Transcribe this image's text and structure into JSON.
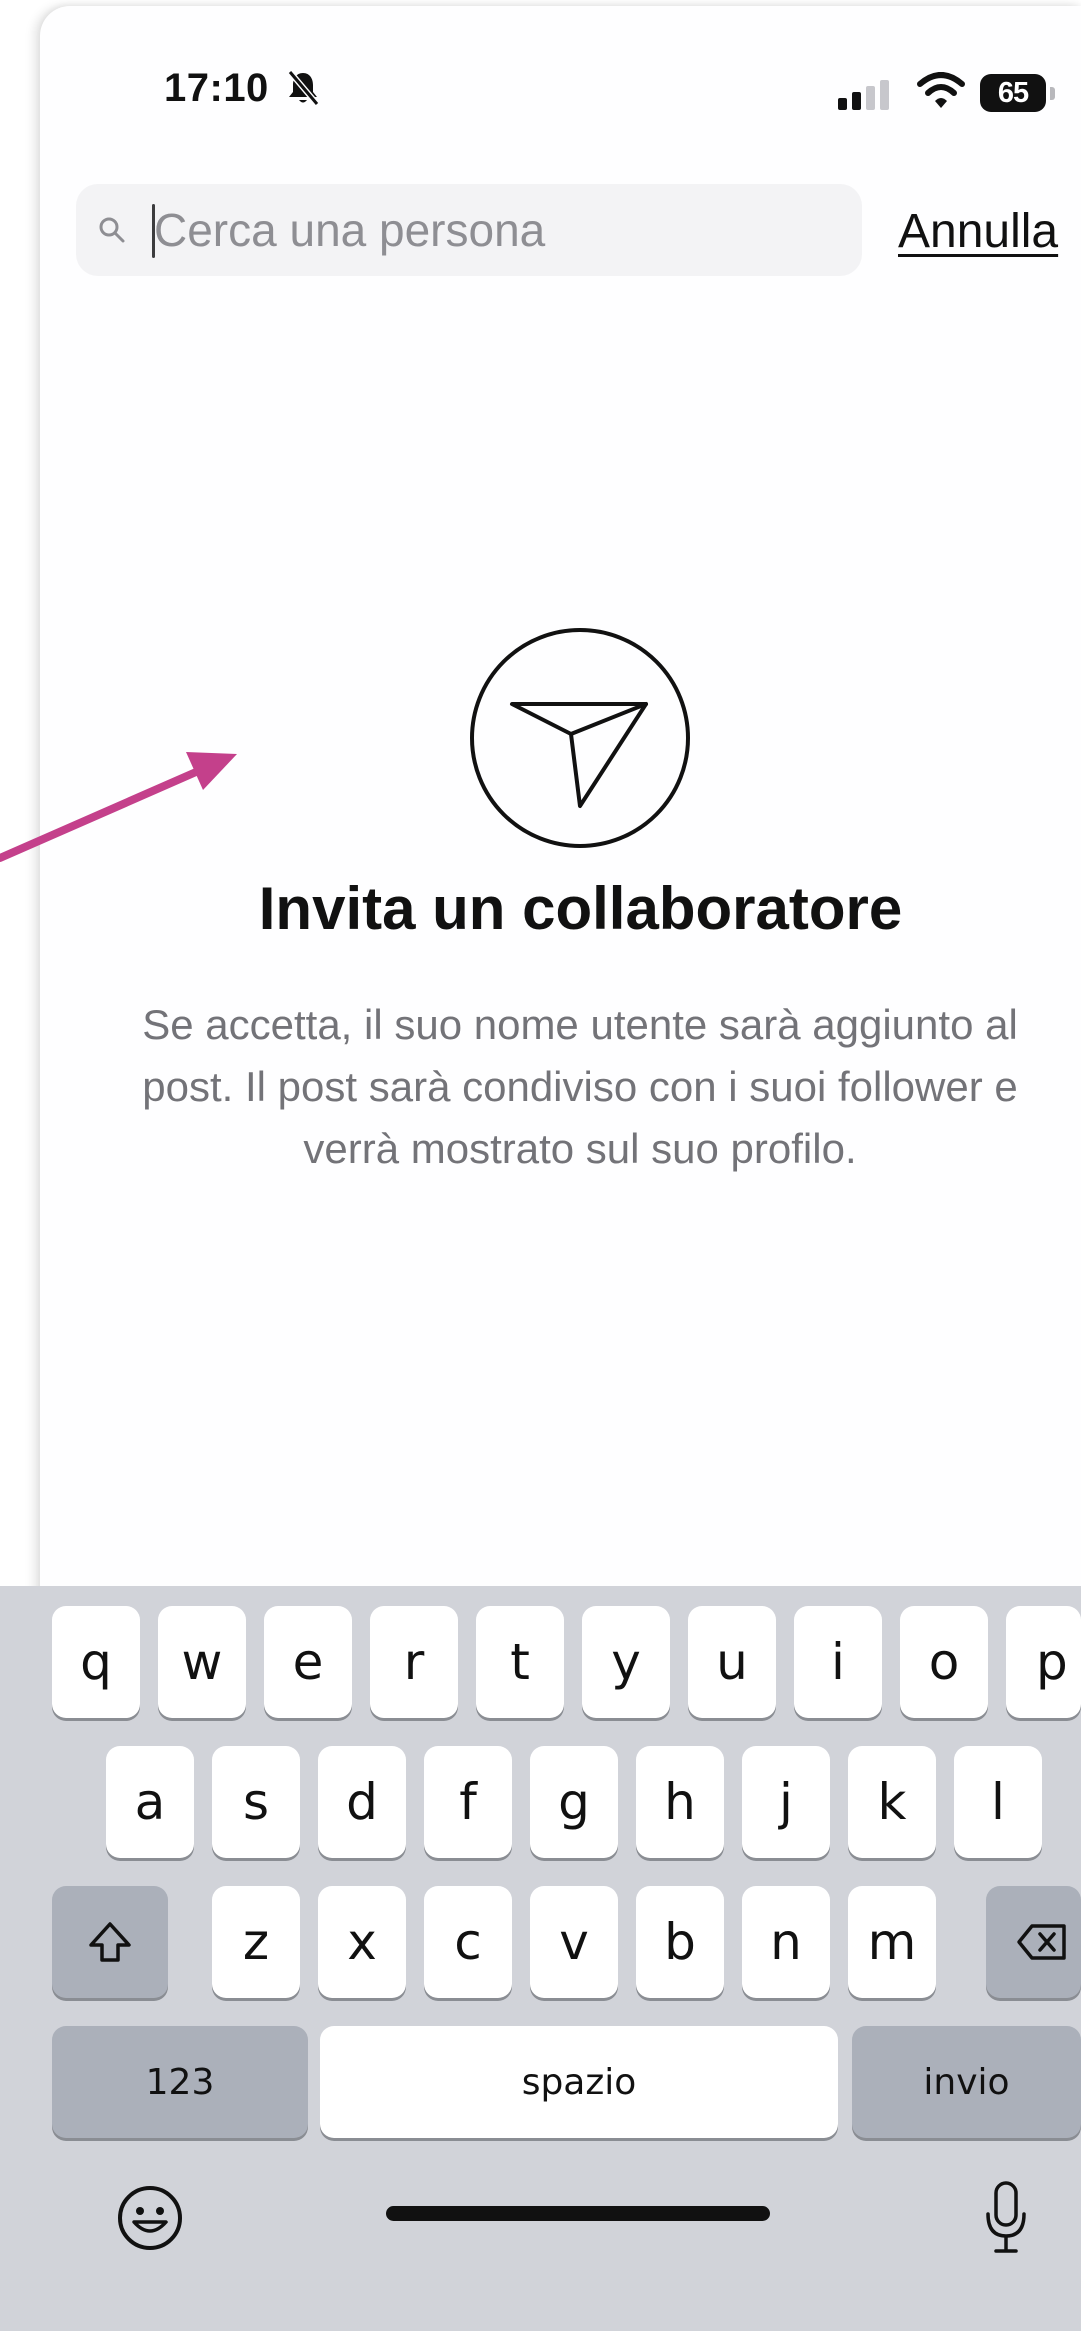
{
  "status_bar": {
    "time": "17:10",
    "battery": "65"
  },
  "search": {
    "placeholder": "Cerca una persona",
    "value": "",
    "cancel_label": "Annulla"
  },
  "empty_state": {
    "title": "Invita un collaboratore",
    "description": "Se accetta, il suo nome utente sarà aggiunto al post. Il post sarà condiviso con i suoi follower e verrà mostrato sul suo profilo."
  },
  "keyboard": {
    "row1": [
      "q",
      "w",
      "e",
      "r",
      "t",
      "y",
      "u",
      "i",
      "o",
      "p"
    ],
    "row2": [
      "a",
      "s",
      "d",
      "f",
      "g",
      "h",
      "j",
      "k",
      "l"
    ],
    "row3": [
      "z",
      "x",
      "c",
      "v",
      "b",
      "n",
      "m"
    ],
    "numbers_label": "123",
    "space_label": "spazio",
    "return_label": "invio"
  },
  "colors": {
    "annotation_arrow": "#c4408b",
    "background": "#fefeff",
    "keyboard": "#d1d3d9"
  }
}
